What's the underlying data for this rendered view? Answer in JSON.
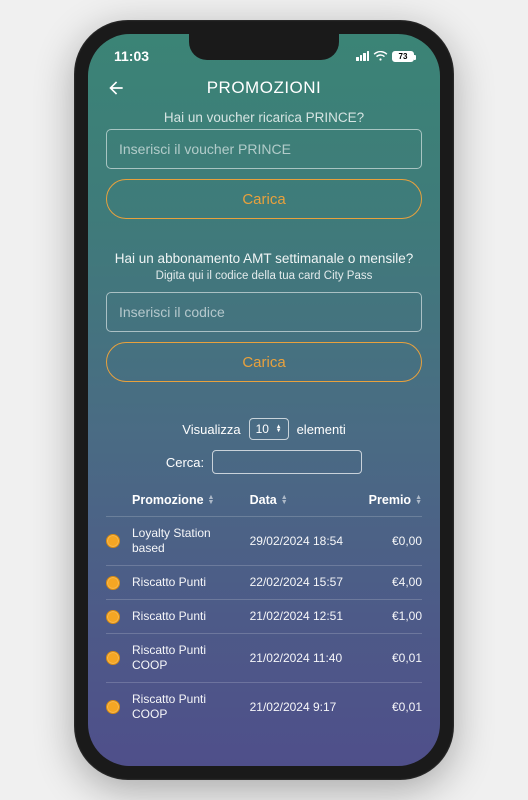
{
  "status": {
    "time": "11:03",
    "battery": "73"
  },
  "header": {
    "title": "PROMOZIONI"
  },
  "voucher": {
    "heading": "Hai un voucher ricarica PRINCE?",
    "placeholder": "Inserisci il voucher PRINCE",
    "button": "Carica"
  },
  "amt": {
    "heading": "Hai un abbonamento AMT settimanale o mensile?",
    "sub": "Digita qui il codice della tua card City Pass",
    "placeholder": "Inserisci il codice",
    "button": "Carica"
  },
  "tableControls": {
    "showLabelPre": "Visualizza",
    "showValue": "10",
    "showLabelPost": "elementi",
    "searchLabel": "Cerca:"
  },
  "columns": {
    "promo": "Promozione",
    "date": "Data",
    "prize": "Premio"
  },
  "rows": [
    {
      "name": "Loyalty Station based",
      "date": "29/02/2024 18:54",
      "prize": "€0,00"
    },
    {
      "name": "Riscatto Punti",
      "date": "22/02/2024 15:57",
      "prize": "€4,00"
    },
    {
      "name": "Riscatto Punti",
      "date": "21/02/2024 12:51",
      "prize": "€1,00"
    },
    {
      "name": "Riscatto Punti COOP",
      "date": "21/02/2024 11:40",
      "prize": "€0,01"
    },
    {
      "name": "Riscatto Punti COOP",
      "date": "21/02/2024 9:17",
      "prize": "€0,01"
    }
  ]
}
